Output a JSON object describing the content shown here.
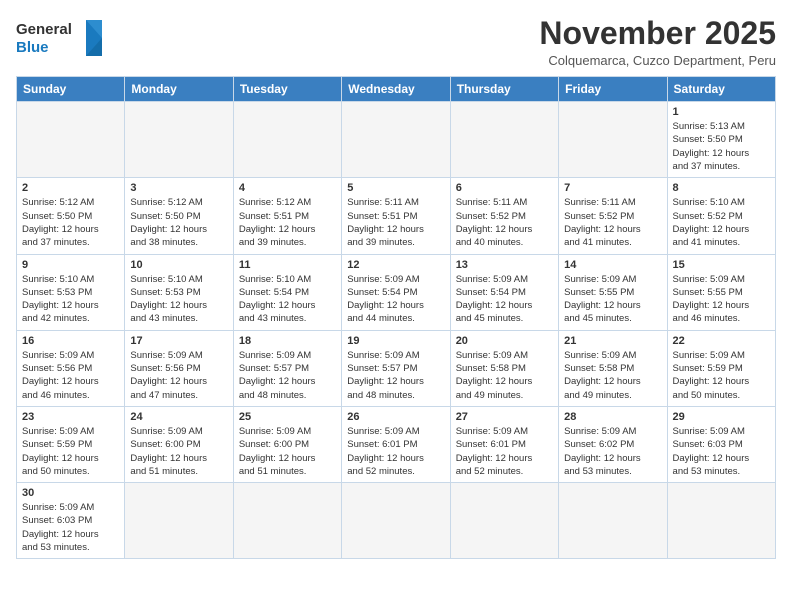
{
  "header": {
    "logo_general": "General",
    "logo_blue": "Blue",
    "month_title": "November 2025",
    "location": "Colquemarca, Cuzco Department, Peru"
  },
  "weekdays": [
    "Sunday",
    "Monday",
    "Tuesday",
    "Wednesday",
    "Thursday",
    "Friday",
    "Saturday"
  ],
  "weeks": [
    [
      {
        "day": "",
        "empty": true
      },
      {
        "day": "",
        "empty": true
      },
      {
        "day": "",
        "empty": true
      },
      {
        "day": "",
        "empty": true
      },
      {
        "day": "",
        "empty": true
      },
      {
        "day": "",
        "empty": true
      },
      {
        "day": "1",
        "sunrise": "5:13 AM",
        "sunset": "5:50 PM",
        "daylight": "12 hours and 37 minutes."
      }
    ],
    [
      {
        "day": "2",
        "sunrise": "5:12 AM",
        "sunset": "5:50 PM",
        "daylight": "12 hours and 37 minutes."
      },
      {
        "day": "3",
        "sunrise": "5:12 AM",
        "sunset": "5:50 PM",
        "daylight": "12 hours and 38 minutes."
      },
      {
        "day": "4",
        "sunrise": "5:12 AM",
        "sunset": "5:51 PM",
        "daylight": "12 hours and 39 minutes."
      },
      {
        "day": "5",
        "sunrise": "5:11 AM",
        "sunset": "5:51 PM",
        "daylight": "12 hours and 39 minutes."
      },
      {
        "day": "6",
        "sunrise": "5:11 AM",
        "sunset": "5:52 PM",
        "daylight": "12 hours and 40 minutes."
      },
      {
        "day": "7",
        "sunrise": "5:11 AM",
        "sunset": "5:52 PM",
        "daylight": "12 hours and 41 minutes."
      },
      {
        "day": "8",
        "sunrise": "5:10 AM",
        "sunset": "5:52 PM",
        "daylight": "12 hours and 41 minutes."
      }
    ],
    [
      {
        "day": "9",
        "sunrise": "5:10 AM",
        "sunset": "5:53 PM",
        "daylight": "12 hours and 42 minutes."
      },
      {
        "day": "10",
        "sunrise": "5:10 AM",
        "sunset": "5:53 PM",
        "daylight": "12 hours and 43 minutes."
      },
      {
        "day": "11",
        "sunrise": "5:10 AM",
        "sunset": "5:54 PM",
        "daylight": "12 hours and 43 minutes."
      },
      {
        "day": "12",
        "sunrise": "5:09 AM",
        "sunset": "5:54 PM",
        "daylight": "12 hours and 44 minutes."
      },
      {
        "day": "13",
        "sunrise": "5:09 AM",
        "sunset": "5:54 PM",
        "daylight": "12 hours and 45 minutes."
      },
      {
        "day": "14",
        "sunrise": "5:09 AM",
        "sunset": "5:55 PM",
        "daylight": "12 hours and 45 minutes."
      },
      {
        "day": "15",
        "sunrise": "5:09 AM",
        "sunset": "5:55 PM",
        "daylight": "12 hours and 46 minutes."
      }
    ],
    [
      {
        "day": "16",
        "sunrise": "5:09 AM",
        "sunset": "5:56 PM",
        "daylight": "12 hours and 46 minutes."
      },
      {
        "day": "17",
        "sunrise": "5:09 AM",
        "sunset": "5:56 PM",
        "daylight": "12 hours and 47 minutes."
      },
      {
        "day": "18",
        "sunrise": "5:09 AM",
        "sunset": "5:57 PM",
        "daylight": "12 hours and 48 minutes."
      },
      {
        "day": "19",
        "sunrise": "5:09 AM",
        "sunset": "5:57 PM",
        "daylight": "12 hours and 48 minutes."
      },
      {
        "day": "20",
        "sunrise": "5:09 AM",
        "sunset": "5:58 PM",
        "daylight": "12 hours and 49 minutes."
      },
      {
        "day": "21",
        "sunrise": "5:09 AM",
        "sunset": "5:58 PM",
        "daylight": "12 hours and 49 minutes."
      },
      {
        "day": "22",
        "sunrise": "5:09 AM",
        "sunset": "5:59 PM",
        "daylight": "12 hours and 50 minutes."
      }
    ],
    [
      {
        "day": "23",
        "sunrise": "5:09 AM",
        "sunset": "5:59 PM",
        "daylight": "12 hours and 50 minutes."
      },
      {
        "day": "24",
        "sunrise": "5:09 AM",
        "sunset": "6:00 PM",
        "daylight": "12 hours and 51 minutes."
      },
      {
        "day": "25",
        "sunrise": "5:09 AM",
        "sunset": "6:00 PM",
        "daylight": "12 hours and 51 minutes."
      },
      {
        "day": "26",
        "sunrise": "5:09 AM",
        "sunset": "6:01 PM",
        "daylight": "12 hours and 52 minutes."
      },
      {
        "day": "27",
        "sunrise": "5:09 AM",
        "sunset": "6:01 PM",
        "daylight": "12 hours and 52 minutes."
      },
      {
        "day": "28",
        "sunrise": "5:09 AM",
        "sunset": "6:02 PM",
        "daylight": "12 hours and 53 minutes."
      },
      {
        "day": "29",
        "sunrise": "5:09 AM",
        "sunset": "6:03 PM",
        "daylight": "12 hours and 53 minutes."
      }
    ],
    [
      {
        "day": "30",
        "sunrise": "5:09 AM",
        "sunset": "6:03 PM",
        "daylight": "12 hours and 53 minutes."
      },
      {
        "day": "",
        "empty": true
      },
      {
        "day": "",
        "empty": true
      },
      {
        "day": "",
        "empty": true
      },
      {
        "day": "",
        "empty": true
      },
      {
        "day": "",
        "empty": true
      },
      {
        "day": "",
        "empty": true
      }
    ]
  ],
  "labels": {
    "sunrise": "Sunrise:",
    "sunset": "Sunset:",
    "daylight": "Daylight:"
  }
}
